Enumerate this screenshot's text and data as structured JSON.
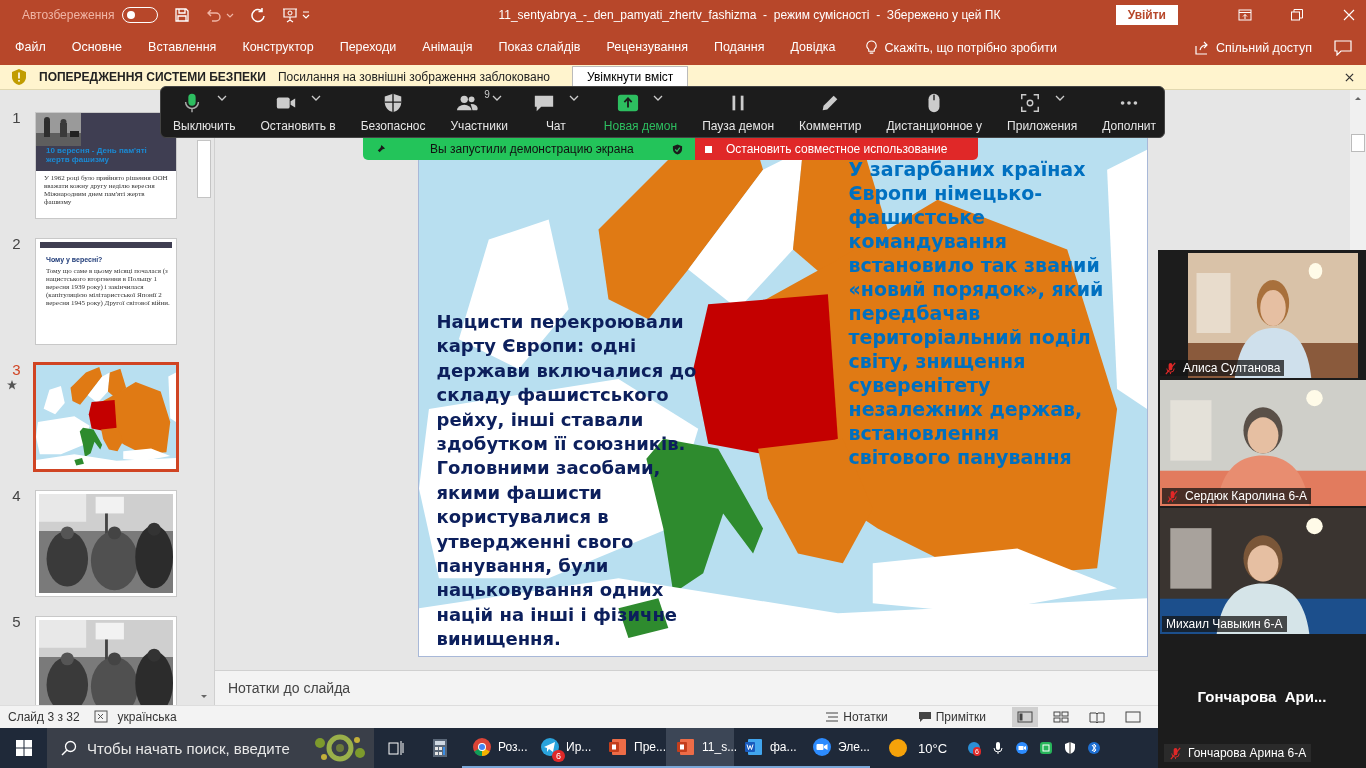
{
  "title_bar": {
    "autosave_label": "Автозбереження",
    "autosave_on": false,
    "document_title": "11_sentyabrya_-_den_pamyati_zhertv_fashizma  -  режим сумісності  -  Збережено у цей ПК",
    "sign_in": "Увійти"
  },
  "ribbon": {
    "tabs": [
      {
        "label": "Файл",
        "selected": false
      },
      {
        "label": "Основне",
        "selected": false
      },
      {
        "label": "Вставлення",
        "selected": false
      },
      {
        "label": "Конструктор",
        "selected": false
      },
      {
        "label": "Переходи",
        "selected": false
      },
      {
        "label": "Анімація",
        "selected": false
      },
      {
        "label": "Показ слайдів",
        "selected": false
      },
      {
        "label": "Рецензування",
        "selected": false
      },
      {
        "label": "Подання",
        "selected": false
      },
      {
        "label": "Довідка",
        "selected": false
      }
    ],
    "tell_me": "Скажіть, що потрібно зробити",
    "share": "Спільний доступ"
  },
  "security_bar": {
    "title": "ПОПЕРЕДЖЕННЯ СИСТЕМИ БЕЗПЕКИ",
    "message": "Посилання на зовнішні зображення заблоковано",
    "button": "Увімкнути вміст"
  },
  "thumbnails": [
    {
      "number": "1",
      "selected": false,
      "animated": false,
      "kind": "title",
      "title": "10 вересня - День пам'яті жертв фашизму",
      "body": "У 1962 році було прийнято рішення ООН вважати кожну другу неділю вересня Міжнародним днем пам'яті жертв фашизму"
    },
    {
      "number": "2",
      "selected": false,
      "animated": false,
      "kind": "text",
      "title": "Чому у вересні?",
      "body": "Тому що саме в цьому місяці почалася (з нацистського вторгнення в Польщу 1 вересня 1939 року) і закінчилася (капітуляцією мілітаристської Японії 2 вересня 1945 року) Другої світової війни."
    },
    {
      "number": "3",
      "selected": true,
      "animated": true,
      "kind": "map"
    },
    {
      "number": "4",
      "selected": false,
      "animated": false
    },
    {
      "number": "5",
      "selected": false,
      "animated": false
    }
  ],
  "slide": {
    "left_text": "Нацисти перекроювали карту Європи: одні держави включалися до складу фашистського рейху, інші ставали здобутком її союзників. Головними засобами, якими фашисти користувалися в утвердженні свого панування, були нацьковування одних націй на інші і фізичне винищення.",
    "right_text": "У загарбаних країнах Європи німецько-фашистське командування встановило так званий «новий порядок», який передбачав територіальний поділ світу, знищення суверенітету незалежних держав, встановлення світового панування"
  },
  "notes_placeholder": "Нотатки до слайда",
  "status_bar": {
    "slide_counter": "Слайд 3 з 32",
    "language": "українська",
    "notes": "Нотатки",
    "comments": "Примітки",
    "views": [
      {
        "kind": "normal",
        "selected": true
      },
      {
        "kind": "sorter",
        "selected": false
      },
      {
        "kind": "reading",
        "selected": false
      },
      {
        "kind": "slideshow",
        "selected": false
      }
    ]
  },
  "taskbar": {
    "search_placeholder": "Чтобы начать поиск, введите",
    "apps": [
      {
        "kind": "taskview",
        "selected": false
      },
      {
        "kind": "calculator",
        "selected": false
      },
      {
        "kind": "chrome",
        "label": "Роз...",
        "selected": false
      },
      {
        "kind": "telegram",
        "label": "Ир...",
        "badge": "6",
        "selected": false
      },
      {
        "kind": "powerpoint",
        "label": "Пре...",
        "selected": false
      },
      {
        "kind": "powerpoint",
        "label": "11_s...",
        "selected": true
      },
      {
        "kind": "word",
        "label": "фа...",
        "selected": false
      },
      {
        "kind": "zoom",
        "label": "Эле...",
        "selected": false
      }
    ],
    "weather": "10°C",
    "tray_badge": "6"
  },
  "zoom_toolbar": {
    "items": [
      {
        "kind": "mic",
        "label": "Выключить",
        "caret": true,
        "highlighted": false
      },
      {
        "kind": "camera",
        "label": "Остановить в",
        "caret": true,
        "highlighted": false
      },
      {
        "kind": "shield",
        "label": "Безопаснос",
        "caret": false,
        "highlighted": false
      },
      {
        "kind": "people",
        "label": "Участники",
        "caret": true,
        "badge": "9",
        "highlighted": false
      },
      {
        "kind": "chat",
        "label": "Чат",
        "caret": true,
        "highlighted": false
      },
      {
        "kind": "share",
        "label": "Новая демон",
        "caret": true,
        "highlighted": true
      },
      {
        "kind": "pause",
        "label": "Пауза демон",
        "caret": false,
        "highlighted": false
      },
      {
        "kind": "pen",
        "label": "Комментир",
        "caret": false,
        "highlighted": false
      },
      {
        "kind": "mouse",
        "label": "Дистанционное у",
        "caret": false,
        "highlighted": false
      },
      {
        "kind": "apps",
        "label": "Приложения",
        "caret": true,
        "highlighted": false
      },
      {
        "kind": "more",
        "label": "Дополнит",
        "caret": false,
        "highlighted": false
      }
    ]
  },
  "share_banner": {
    "status": "Вы запустили демонстрацию экрана",
    "stop": "Остановить совместное использование"
  },
  "video_panel": {
    "tiles": [
      {
        "name": "Алиса Султанова",
        "muted": true
      },
      {
        "name": "Сердюк Каролина 6-А",
        "muted": true
      },
      {
        "name": "Михаил Чавыкин 6-А",
        "muted": false
      }
    ],
    "active_speaker": "Гончарова  Ари...",
    "self": {
      "name": "Гончарова Арина 6-А",
      "muted": true
    }
  }
}
